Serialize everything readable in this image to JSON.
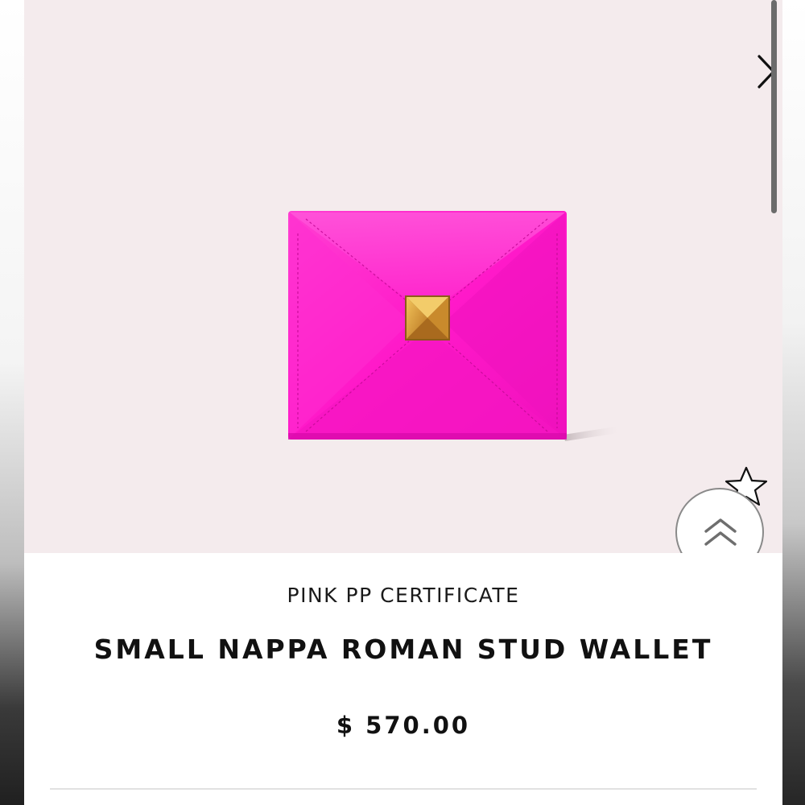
{
  "hero": {
    "background_color": "#f4ebed",
    "next_icon": "chevron-right-icon",
    "product_image": {
      "subject": "hot pink quilted nappa wallet with gold pyramid stud",
      "wallet_color": "#ff1fc8",
      "stud_color": "#d79a2e"
    },
    "favorite_icon": "star-outline-icon",
    "scroll_top_icon": "double-chevron-up-icon"
  },
  "product": {
    "brand_line": "PINK PP CERTIFICATE",
    "title": "SMALL NAPPA ROMAN STUD WALLET",
    "price": "$ 570.00"
  }
}
